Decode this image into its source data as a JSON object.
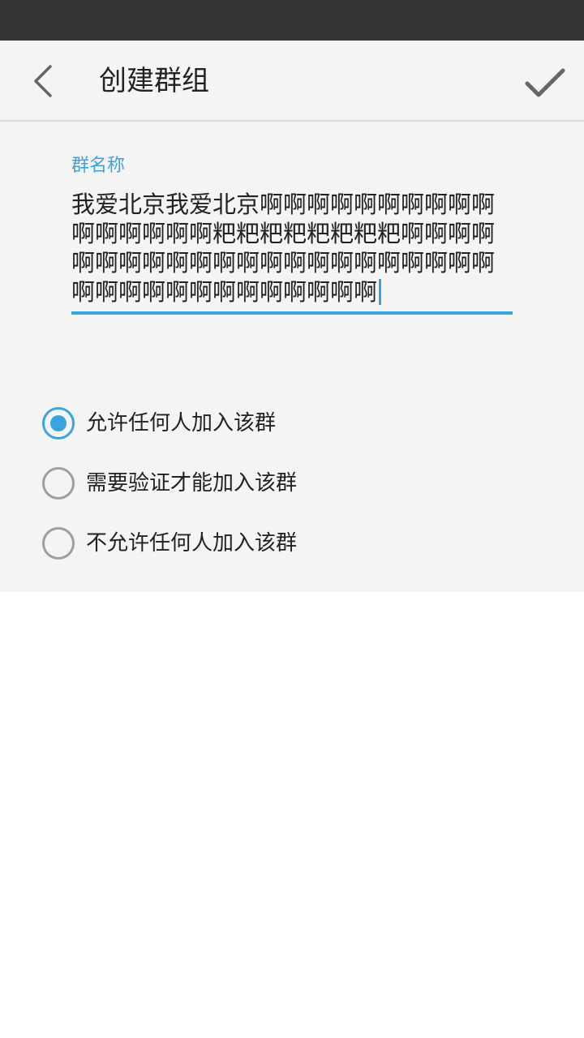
{
  "toolbar": {
    "back_icon": "chevron-left-icon",
    "title": "创建群组",
    "confirm_icon": "check-icon"
  },
  "group_name": {
    "label": "群名称",
    "value": "我爱北京我爱北京啊啊啊啊啊啊啊啊啊啊啊啊啊啊啊啊粑粑粑粑粑粑粑粑啊啊啊啊啊啊啊啊啊啊啊啊啊啊啊啊啊啊啊啊啊啊啊啊啊啊啊啊啊啊啊啊啊啊啊"
  },
  "join_options": [
    {
      "label": "允许任何人加入该群",
      "selected": true
    },
    {
      "label": "需要验证才能加入该群",
      "selected": false
    },
    {
      "label": "不允许任何人加入该群",
      "selected": false
    }
  ],
  "colors": {
    "accent": "#3aa4e0",
    "status_bar": "#333333",
    "panel_bg": "#f4f4f4"
  }
}
